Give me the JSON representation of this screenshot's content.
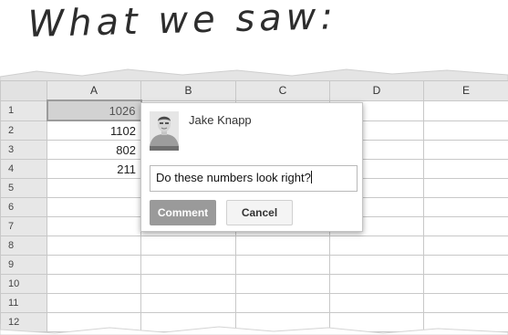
{
  "heading": "What we saw:",
  "spreadsheet": {
    "columns": [
      "A",
      "B",
      "C",
      "D",
      "E"
    ],
    "rows": [
      {
        "num": "1",
        "a": "1026"
      },
      {
        "num": "2",
        "a": "1102"
      },
      {
        "num": "3",
        "a": "802"
      },
      {
        "num": "4",
        "a": "211"
      },
      {
        "num": "5",
        "a": ""
      },
      {
        "num": "6",
        "a": ""
      },
      {
        "num": "7",
        "a": ""
      },
      {
        "num": "8",
        "a": ""
      },
      {
        "num": "9",
        "a": ""
      },
      {
        "num": "10",
        "a": ""
      },
      {
        "num": "11",
        "a": ""
      },
      {
        "num": "12",
        "a": ""
      }
    ],
    "selected_cell": "A1"
  },
  "comment_popup": {
    "author": "Jake Knapp",
    "avatar_icon": "person-photo-icon",
    "input_value": "Do these numbers look right?",
    "comment_button": "Comment",
    "cancel_button": "Cancel"
  },
  "colors": {
    "comment_button_bg": "#9a9a9a",
    "header_bg": "#e7e7e7",
    "selected_cell_bg": "#d2d2d2"
  }
}
